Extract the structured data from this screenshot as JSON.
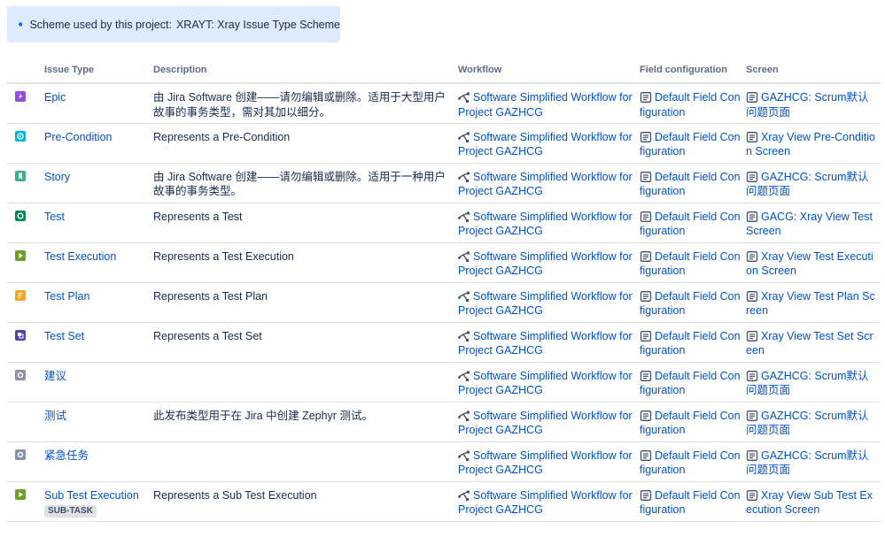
{
  "banner": {
    "label": "Scheme used by this project:",
    "scheme_name": "XRAYT: Xray Issue Type Scheme"
  },
  "table": {
    "headers": {
      "issue_type": "Issue Type",
      "description": "Description",
      "workflow": "Workflow",
      "field_configuration": "Field configuration",
      "screen": "Screen"
    },
    "rows": [
      {
        "icon": "epic-icon",
        "icon_color": "#904ee2",
        "name": "Epic",
        "description": "由 Jira Software 创建——请勿编辑或删除。适用于大型用户故事的事务类型，需对其加以细分。",
        "workflow": "Software Simplified Workflow for Project GAZHCG",
        "field_config": "Default Field Configuration",
        "screen": "GAZHCG: Scrum默认问题页面"
      },
      {
        "icon": "pre-condition-icon",
        "icon_color": "#00b8d9",
        "name": "Pre-Condition",
        "description": "Represents a Pre-Condition",
        "workflow": "Software Simplified Workflow for Project GAZHCG",
        "field_config": "Default Field Configuration",
        "screen": "Xray View Pre-Condition Screen"
      },
      {
        "icon": "story-icon",
        "icon_color": "#36b37e",
        "name": "Story",
        "description": "由 Jira Software 创建——请勿编辑或删除。适用于一种用户故事的事务类型。",
        "workflow": "Software Simplified Workflow for Project GAZHCG",
        "field_config": "Default Field Configuration",
        "screen": "GAZHCG: Scrum默认问题页面"
      },
      {
        "icon": "test-icon",
        "icon_color": "#00875a",
        "name": "Test",
        "description": "Represents a Test",
        "workflow": "Software Simplified Workflow for Project GAZHCG",
        "field_config": "Default Field Configuration",
        "screen": "GACG: Xray View Test Screen"
      },
      {
        "icon": "test-execution-icon",
        "icon_color": "#6b9f2a",
        "name": "Test Execution",
        "description": "Represents a Test Execution",
        "workflow": "Software Simplified Workflow for Project GAZHCG",
        "field_config": "Default Field Configuration",
        "screen": "Xray View Test Execution Screen"
      },
      {
        "icon": "test-plan-icon",
        "icon_color": "#f5a623",
        "name": "Test Plan",
        "description": "Represents a Test Plan",
        "workflow": "Software Simplified Workflow for Project GAZHCG",
        "field_config": "Default Field Configuration",
        "screen": "Xray View Test Plan Screen"
      },
      {
        "icon": "test-set-icon",
        "icon_color": "#5243aa",
        "name": "Test Set",
        "description": "Represents a Test Set",
        "workflow": "Software Simplified Workflow for Project GAZHCG",
        "field_config": "Default Field Configuration",
        "screen": "Xray View Test Set Screen"
      },
      {
        "icon": "suggestion-icon",
        "icon_color": "#8993a4",
        "name": "建议",
        "description": "",
        "workflow": "Software Simplified Workflow for Project GAZHCG",
        "field_config": "Default Field Configuration",
        "screen": "GAZHCG: Scrum默认问题页面"
      },
      {
        "icon": "",
        "icon_color": "",
        "name": "测试",
        "description": "此发布类型用于在 Jira 中创建 Zephyr 测试。",
        "workflow": "Software Simplified Workflow for Project GAZHCG",
        "field_config": "Default Field Configuration",
        "screen": "GAZHCG: Scrum默认问题页面"
      },
      {
        "icon": "urgent-task-icon",
        "icon_color": "#8993a4",
        "name": "紧急任务",
        "description": "",
        "workflow": "Software Simplified Workflow for Project GAZHCG",
        "field_config": "Default Field Configuration",
        "screen": "GAZHCG: Scrum默认问题页面"
      },
      {
        "icon": "sub-test-execution-icon",
        "icon_color": "#6b9f2a",
        "name": "Sub Test Execution",
        "badge": "SUB-TASK",
        "description": "Represents a Sub Test Execution",
        "workflow": "Software Simplified Workflow for Project GAZHCG",
        "field_config": "Default Field Configuration",
        "screen": "Xray View Sub Test Execution Screen"
      }
    ]
  }
}
